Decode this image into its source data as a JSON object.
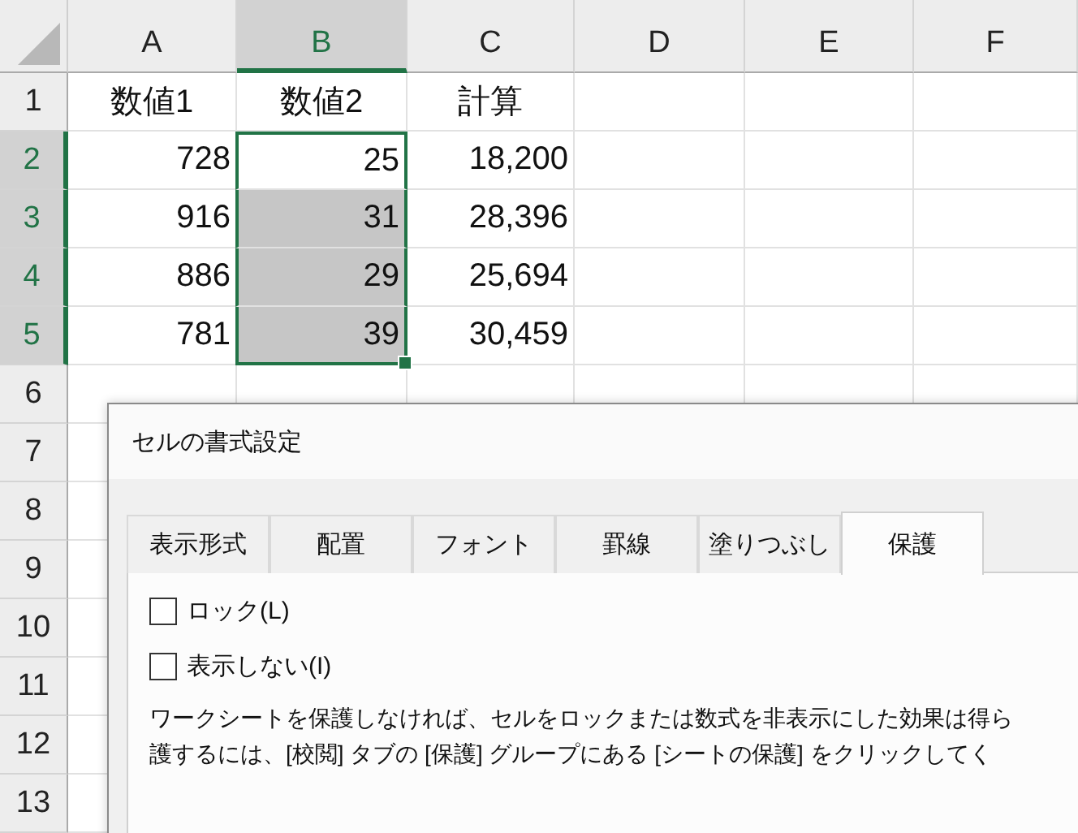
{
  "sheet": {
    "columns": [
      {
        "label": "A",
        "selected": false
      },
      {
        "label": "B",
        "selected": true
      },
      {
        "label": "C",
        "selected": false
      },
      {
        "label": "D",
        "selected": false
      },
      {
        "label": "E",
        "selected": false
      },
      {
        "label": "F",
        "selected": false
      }
    ],
    "rows": [
      {
        "number": "1",
        "selected": false,
        "cells": [
          {
            "text": "数値1",
            "kind": "label",
            "selected": false
          },
          {
            "text": "数値2",
            "kind": "label",
            "selected": false
          },
          {
            "text": "計算",
            "kind": "label",
            "selected": false
          }
        ]
      },
      {
        "number": "2",
        "selected": true,
        "cells": [
          {
            "text": "728",
            "kind": "number",
            "selected": false
          },
          {
            "text": "25",
            "kind": "number",
            "selected": false
          },
          {
            "text": "18,200",
            "kind": "number",
            "selected": false
          }
        ]
      },
      {
        "number": "3",
        "selected": true,
        "cells": [
          {
            "text": "916",
            "kind": "number",
            "selected": false
          },
          {
            "text": "31",
            "kind": "number",
            "selected": true
          },
          {
            "text": "28,396",
            "kind": "number",
            "selected": false
          }
        ]
      },
      {
        "number": "4",
        "selected": true,
        "cells": [
          {
            "text": "886",
            "kind": "number",
            "selected": false
          },
          {
            "text": "29",
            "kind": "number",
            "selected": true
          },
          {
            "text": "25,694",
            "kind": "number",
            "selected": false
          }
        ]
      },
      {
        "number": "5",
        "selected": true,
        "cells": [
          {
            "text": "781",
            "kind": "number",
            "selected": false
          },
          {
            "text": "39",
            "kind": "number",
            "selected": true
          },
          {
            "text": "30,459",
            "kind": "number",
            "selected": false
          }
        ]
      },
      {
        "number": "6",
        "selected": false
      },
      {
        "number": "7",
        "selected": false
      },
      {
        "number": "8",
        "selected": false
      },
      {
        "number": "9",
        "selected": false
      },
      {
        "number": "10",
        "selected": false
      },
      {
        "number": "11",
        "selected": false
      },
      {
        "number": "12",
        "selected": false
      },
      {
        "number": "13",
        "selected": false
      }
    ]
  },
  "dialog": {
    "title": "セルの書式設定",
    "tabs": [
      {
        "label": "表示形式",
        "selected": false
      },
      {
        "label": "配置",
        "selected": false
      },
      {
        "label": "フォント",
        "selected": false
      },
      {
        "label": "罫線",
        "selected": false
      },
      {
        "label": "塗りつぶし",
        "selected": false
      },
      {
        "label": "保護",
        "selected": true
      }
    ],
    "checkboxes": [
      {
        "label": "ロック(L)",
        "checked": false
      },
      {
        "label": "表示しない(I)",
        "checked": false
      }
    ],
    "description": [
      "ワークシートを保護しなければ、セルをロックまたは数式を非表示にした効果は得ら",
      "護するには、[校閲] タブの [保護] グループにある [シートの保護] をクリックしてく"
    ]
  }
}
